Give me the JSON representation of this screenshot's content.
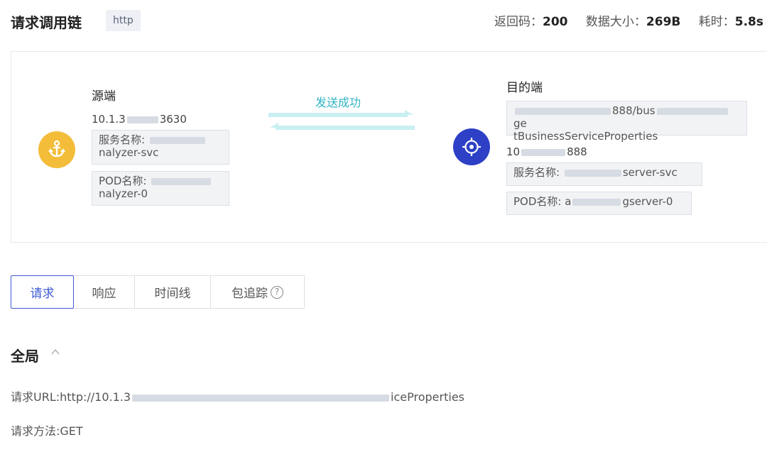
{
  "header": {
    "title": "请求调用链",
    "tag": "http",
    "return_code_label": "返回码：",
    "return_code": "200",
    "data_size_label": "数据大小：",
    "data_size": "269B",
    "duration_label": "耗时：",
    "duration": "5.8s"
  },
  "source": {
    "label": "源端",
    "ip_prefix": "10.1.3",
    "ip_suffix": "3630",
    "service_label": "服务名称: ",
    "service_tail": "nalyzer-svc",
    "pod_label": "POD名称: ",
    "pod_tail": "nalyzer-0",
    "icon": "anchor-icon",
    "color": "#f3bd3a"
  },
  "flow": {
    "status": "发送成功",
    "arrow_color": "#c9eff2"
  },
  "destination": {
    "label": "目的端",
    "url_mid": "888/bus",
    "url_tail": "tBusinessServiceProperties",
    "url_end": "ge",
    "ip_prefix": "10",
    "ip_suffix": "888",
    "service_label": "服务名称: ",
    "service_tail": "server-svc",
    "pod_label": "POD名称: ",
    "pod_prefix": "a",
    "pod_tail": "gserver-0",
    "icon": "target-icon",
    "color": "#2d40c6"
  },
  "tabs": [
    {
      "label": "请求",
      "active": true
    },
    {
      "label": "响应"
    },
    {
      "label": "时间线"
    },
    {
      "label": "包追踪",
      "icon": "help-icon"
    }
  ],
  "global": {
    "title": "全局",
    "url_label": "请求URL:http://10.1.3",
    "url_tail": "iceProperties",
    "method": "请求方法:GET"
  }
}
